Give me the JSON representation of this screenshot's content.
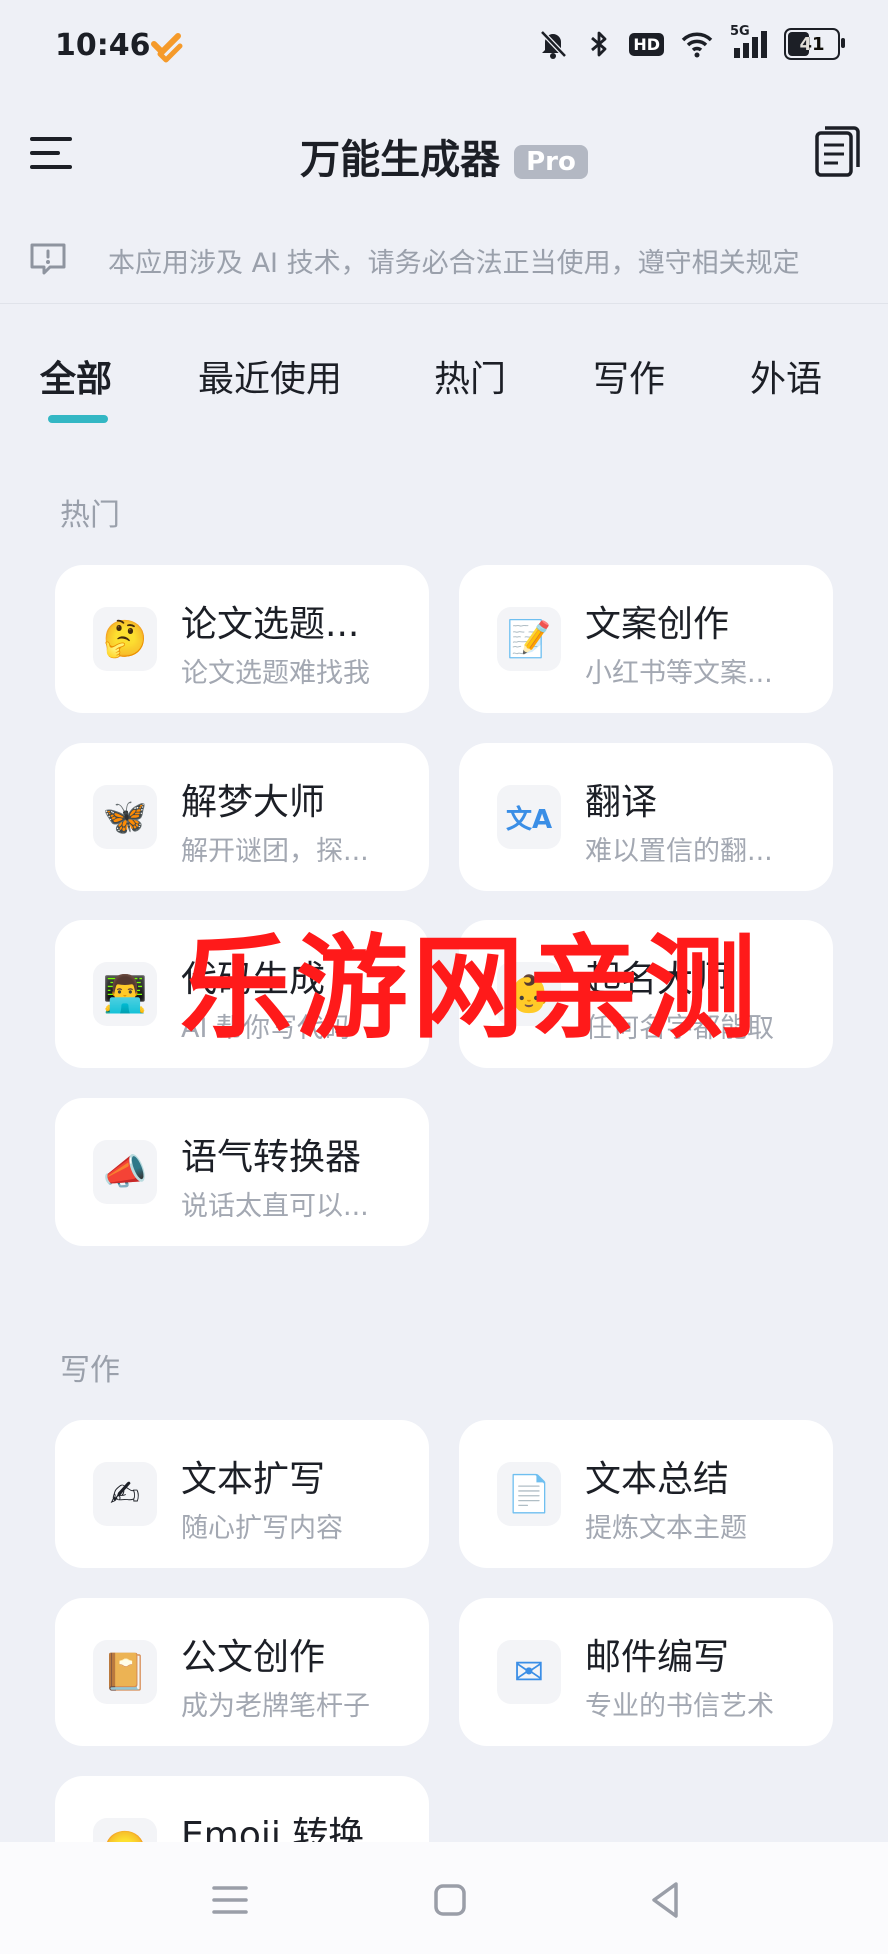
{
  "status_bar": {
    "time": "10:46",
    "hd_label": "HD",
    "signal_label": "5G",
    "battery": "41"
  },
  "header": {
    "title": "万能生成器",
    "badge": "Pro"
  },
  "notice": {
    "text": "本应用涉及 AI 技术，请务必合法正当使用，遵守相关规定"
  },
  "tabs": [
    "全部",
    "最近使用",
    "热门",
    "写作",
    "外语"
  ],
  "sections": [
    {
      "title": "热门",
      "cards": [
        {
          "title": "论文选题...",
          "subtitle": "论文选题难找我",
          "icon": "thinking-face-icon",
          "glyph": "🤔"
        },
        {
          "title": "文案创作",
          "subtitle": "小红书等文案...",
          "icon": "memo-icon",
          "glyph": "📝"
        },
        {
          "title": "解梦大师",
          "subtitle": "解开谜团，探...",
          "icon": "butterfly-icon",
          "glyph": "🦋"
        },
        {
          "title": "翻译",
          "subtitle": "难以置信的翻...",
          "icon": "translate-icon",
          "glyph": "文A"
        },
        {
          "title": "代码生成",
          "subtitle": "AI 帮你写代码",
          "icon": "technologist-icon",
          "glyph": "👨‍💻"
        },
        {
          "title": "起名大师",
          "subtitle": "任何名字都能取",
          "icon": "baby-icon",
          "glyph": "👶"
        },
        {
          "title": "语气转换器",
          "subtitle": "说话太直可以...",
          "icon": "megaphone-icon",
          "glyph": "📣"
        }
      ]
    },
    {
      "title": "写作",
      "cards": [
        {
          "title": "文本扩写",
          "subtitle": "随心扩写内容",
          "icon": "writing-hand-icon",
          "glyph": "✍"
        },
        {
          "title": "文本总结",
          "subtitle": "提炼文本主题",
          "icon": "document-icon",
          "glyph": "📄"
        },
        {
          "title": "公文创作",
          "subtitle": "成为老牌笔杆子",
          "icon": "notebook-icon",
          "glyph": "📔"
        },
        {
          "title": "邮件编写",
          "subtitle": "专业的书信艺术",
          "icon": "envelope-icon",
          "glyph": "✉"
        },
        {
          "title": "Emoji 转换",
          "subtitle": "",
          "icon": "smiley-icon",
          "glyph": "🙂"
        }
      ]
    }
  ],
  "watermark": "乐游网亲测",
  "colors": {
    "accent": "#33b7c4",
    "background": "#eef0f6",
    "watermark": "#ff1a1a"
  }
}
